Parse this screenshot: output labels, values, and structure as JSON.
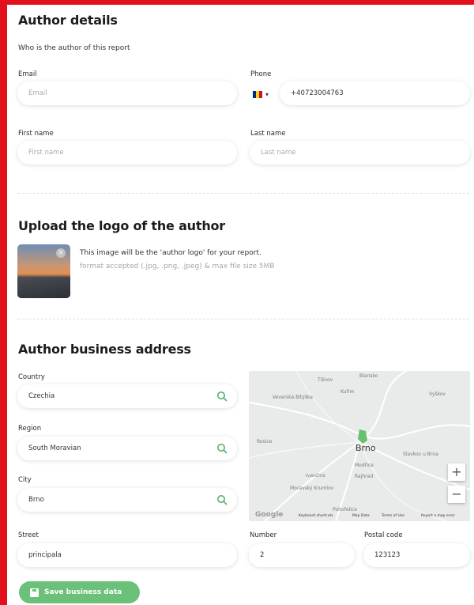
{
  "author_details": {
    "title": "Author details",
    "subtitle": "Who is the author of this report",
    "email": {
      "label": "Email",
      "placeholder": "Email",
      "value": ""
    },
    "phone": {
      "label": "Phone",
      "value": "+40723004763",
      "country_flag": "ro-flag-icon"
    },
    "first_name": {
      "label": "First name",
      "placeholder": "First name",
      "value": ""
    },
    "last_name": {
      "label": "Last name",
      "placeholder": "Last name",
      "value": ""
    }
  },
  "logo": {
    "title": "Upload the logo of the author",
    "description": "This image will be the 'author logo' for your report.",
    "format_note": "format accepted (.jpg, .png, .jpeg) & max file size 5MB"
  },
  "address": {
    "title": "Author business address",
    "country": {
      "label": "Country",
      "value": "Czechia"
    },
    "region": {
      "label": "Region",
      "value": "South Moravian"
    },
    "city": {
      "label": "City",
      "value": "Brno"
    },
    "street": {
      "label": "Street",
      "value": "principala"
    },
    "number": {
      "label": "Number",
      "value": "2"
    },
    "postal_code": {
      "label": "Postal code",
      "value": "123123"
    }
  },
  "map": {
    "city_label": "Brno",
    "place_labels": [
      "Tišnov",
      "Blansko",
      "Kuřim",
      "Vyškov",
      "Veverská Bítýška",
      "Rosice",
      "Modřice",
      "Rajhrad",
      "Ivančice",
      "Slavkov u Brna",
      "Moravský Krumlov",
      "Pohořelice"
    ],
    "zoom_in": "+",
    "zoom_out": "−",
    "footer": [
      "Keyboard shortcuts",
      "Map Data",
      "Terms of Use",
      "Report a map error"
    ],
    "brand": "Google"
  },
  "save_button": {
    "label": "Save business data"
  },
  "colors": {
    "accent": "#6bc07a",
    "frame": "#e2101a",
    "search_icon": "#57b26a"
  }
}
